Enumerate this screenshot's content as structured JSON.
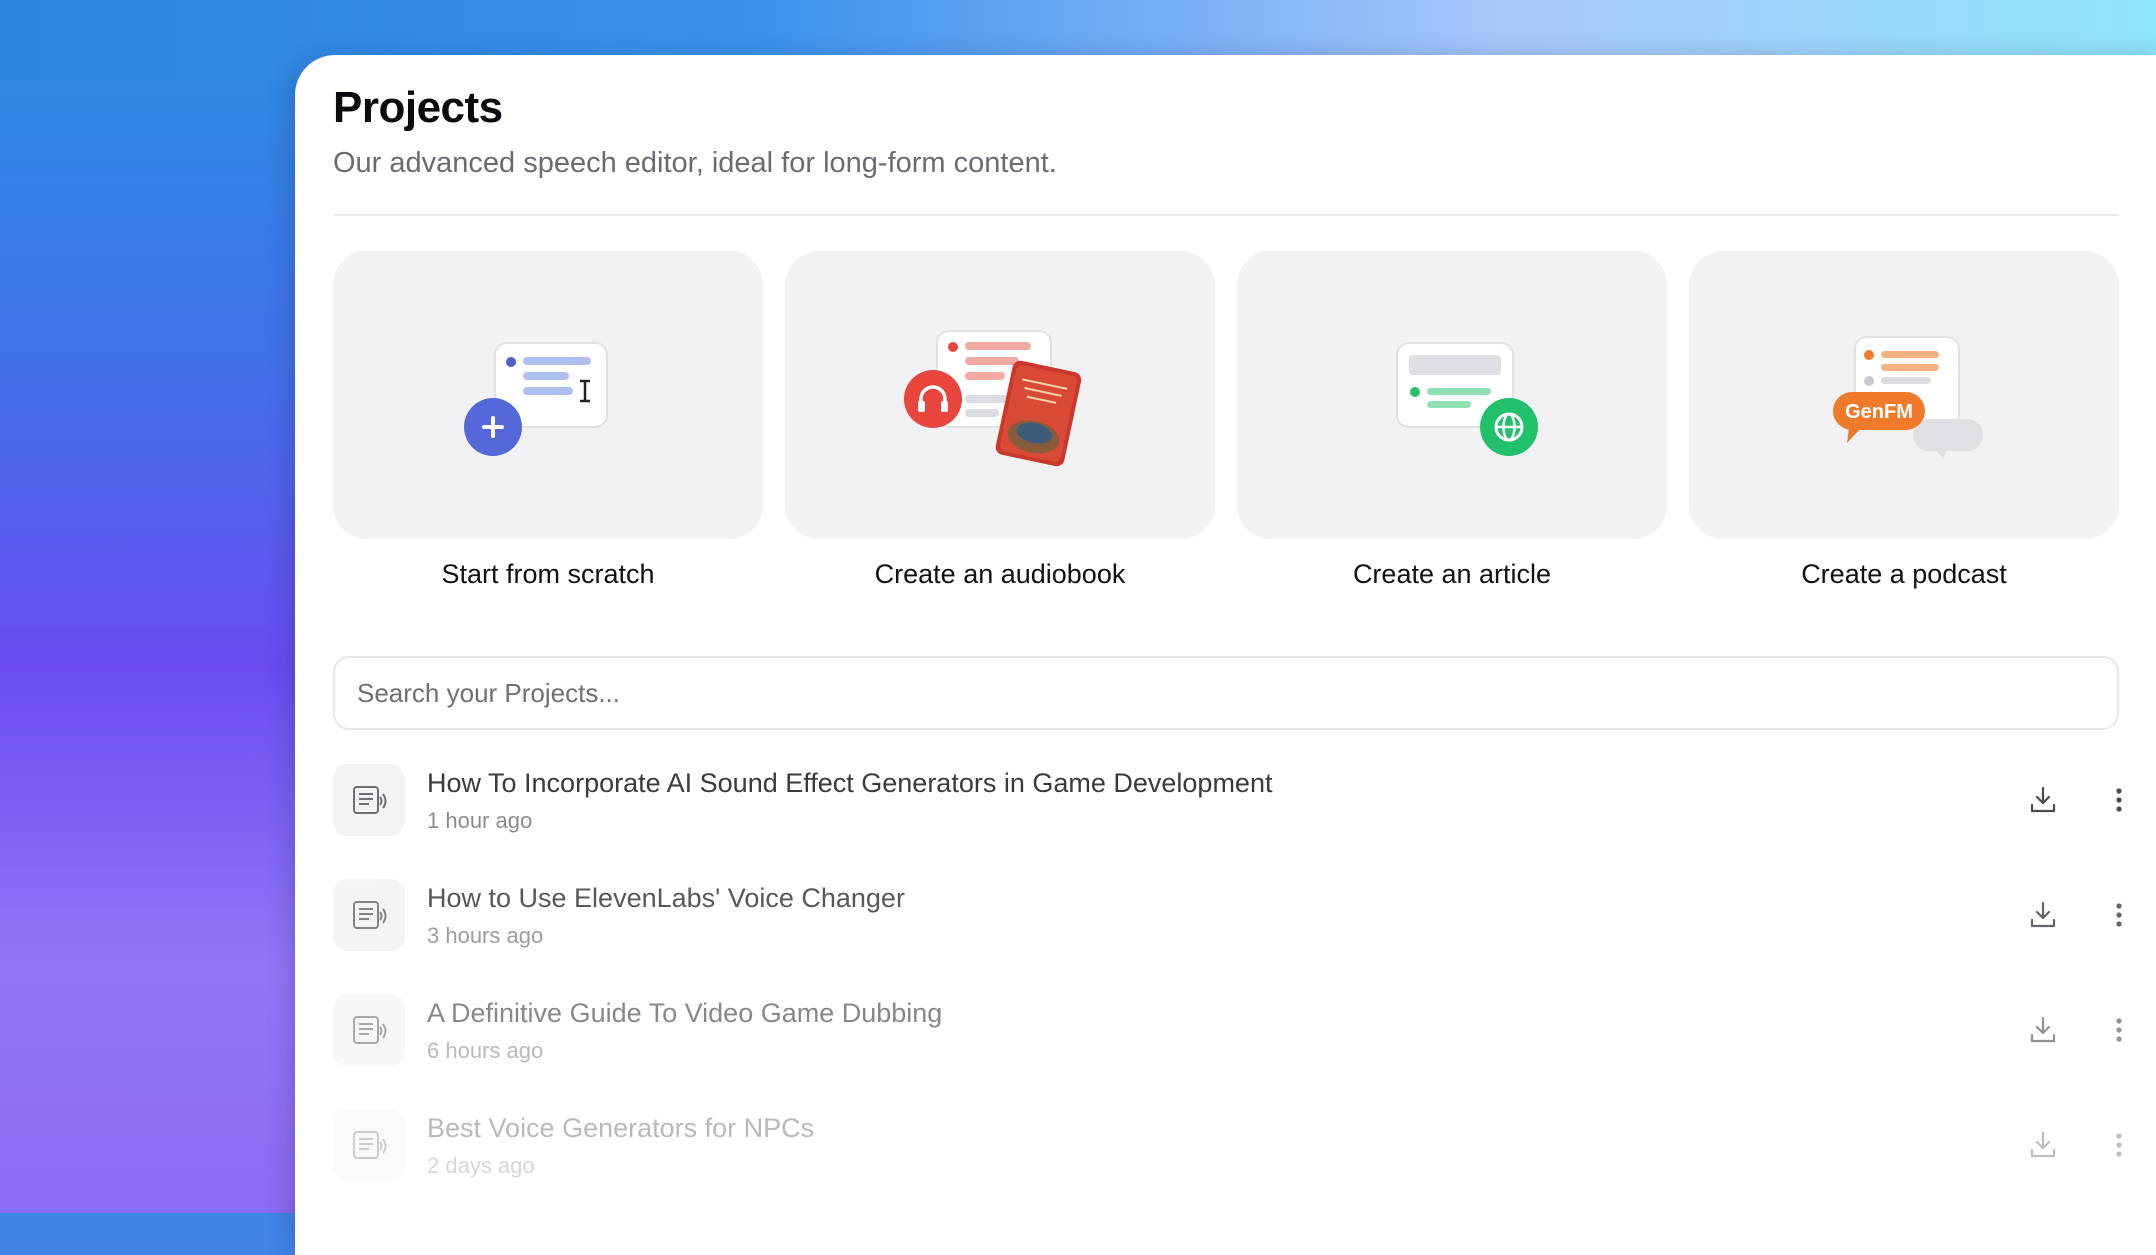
{
  "page": {
    "title": "Projects",
    "subtitle": "Our advanced speech editor, ideal for long-form content."
  },
  "cards": [
    {
      "label": "Start from scratch",
      "icon": "plus-icon"
    },
    {
      "label": "Create an audiobook",
      "icon": "headphones-icon"
    },
    {
      "label": "Create an article",
      "icon": "globe-icon"
    },
    {
      "label": "Create a podcast",
      "icon": "genfm-badge",
      "badge": "GenFM"
    }
  ],
  "search": {
    "placeholder": "Search your Projects...",
    "value": ""
  },
  "projects": [
    {
      "title": "How To Incorporate AI Sound Effect Generators in Game Development",
      "time": "1 hour ago"
    },
    {
      "title": "How to Use ElevenLabs' Voice Changer",
      "time": "3 hours ago"
    },
    {
      "title": "A Definitive Guide To Video Game Dubbing",
      "time": "6 hours ago"
    },
    {
      "title": "Best Voice Generators for NPCs",
      "time": "2 days ago"
    }
  ],
  "colors": {
    "plus_button": "#5468d9",
    "headphones_button": "#e8453c",
    "globe_button": "#21c16b",
    "genfm_badge": "#f07a2a"
  }
}
